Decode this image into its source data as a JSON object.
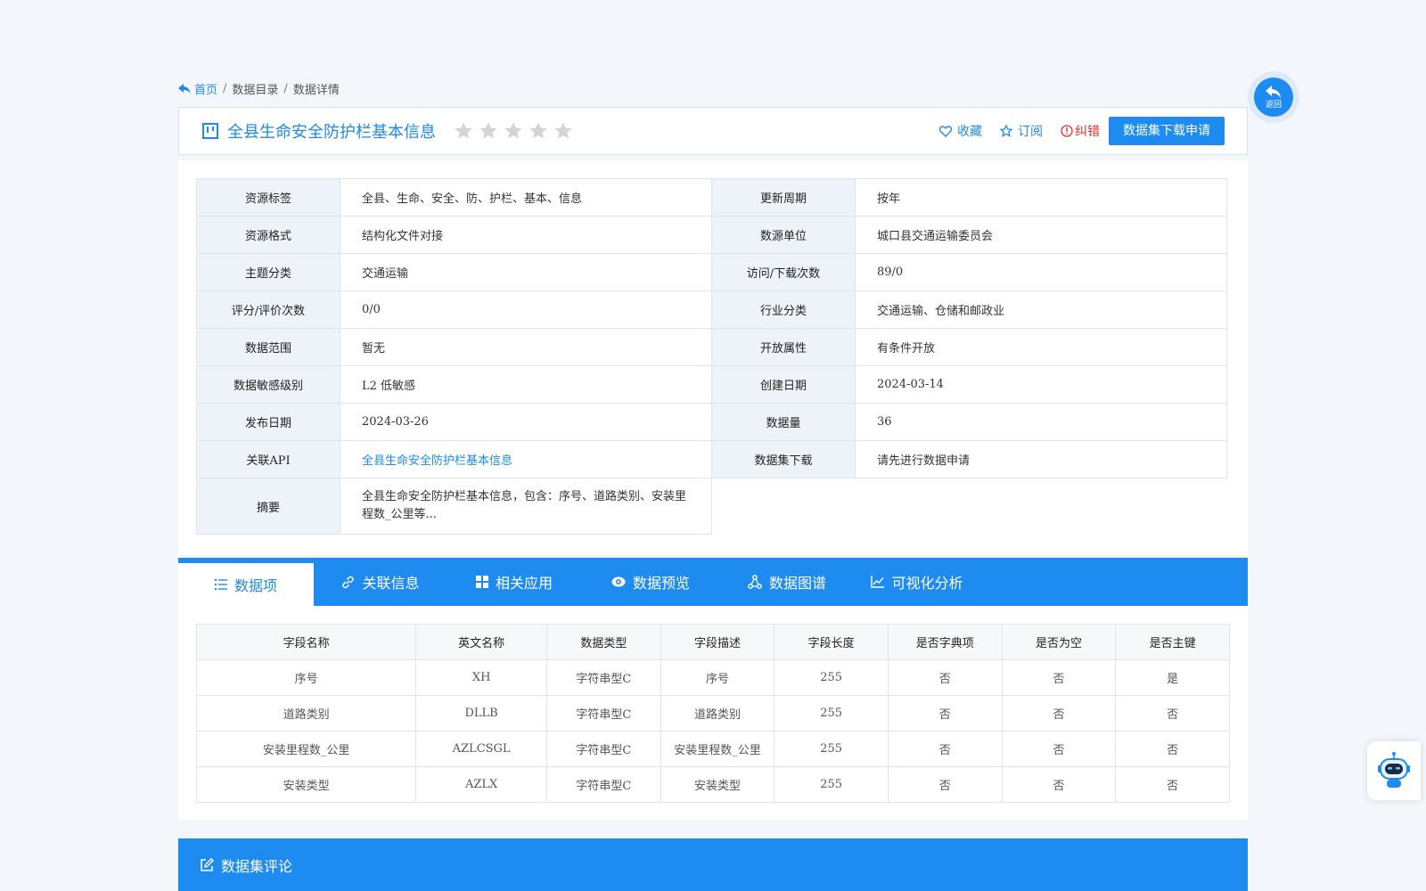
{
  "breadcrumb": {
    "home": "首页",
    "sep1": "/",
    "catalog": "数据目录",
    "sep2": "/",
    "detail": "数据详情"
  },
  "title": {
    "text": "全县生命安全防护栏基本信息",
    "rating_stars": 5,
    "rating_value": 0
  },
  "actions": {
    "favorite": "收藏",
    "subscribe": "订阅",
    "report_error": "纠错",
    "apply": "数据集下载申请"
  },
  "colors": {
    "primary": "#1e8bf0",
    "error": "#e0322d",
    "star": "#d4d4d4"
  },
  "info": {
    "rows": [
      {
        "k1": "资源标签",
        "v1": "全县、生命、安全、防、护栏、基本、信息",
        "k2": "更新周期",
        "v2": "按年"
      },
      {
        "k1": "资源格式",
        "v1": "结构化文件对接",
        "k2": "数源单位",
        "v2": "城口县交通运输委员会"
      },
      {
        "k1": "主题分类",
        "v1": "交通运输",
        "k2": "访问/下载次数",
        "v2": "89/0"
      },
      {
        "k1": "评分/评价次数",
        "v1": "0/0",
        "k2": "行业分类",
        "v2": "交通运输、仓储和邮政业"
      },
      {
        "k1": "数据范围",
        "v1": "暂无",
        "k2": "开放属性",
        "v2": "有条件开放"
      },
      {
        "k1": "数据敏感级别",
        "v1": "L2 低敏感",
        "k2": "创建日期",
        "v2": "2024-03-14"
      },
      {
        "k1": "发布日期",
        "v1": "2024-03-26",
        "k2": "数据量",
        "v2": "36"
      },
      {
        "k1": "关联API",
        "v1": "全县生命安全防护栏基本信息",
        "k2": "数据集下载",
        "v2": "请先进行数据申请"
      }
    ],
    "summary_label": "摘要",
    "summary_value": "全县生命安全防护栏基本信息，包含：序号、道路类别、安装里程数_公里等..."
  },
  "tabs": [
    {
      "label": "数据项",
      "icon": "list-icon"
    },
    {
      "label": "关联信息",
      "icon": "link-icon"
    },
    {
      "label": "相关应用",
      "icon": "grid-icon"
    },
    {
      "label": "数据预览",
      "icon": "eye-icon"
    },
    {
      "label": "数据图谱",
      "icon": "graph-icon"
    },
    {
      "label": "可视化分析",
      "icon": "line-chart-icon"
    }
  ],
  "fields": {
    "headers": [
      "字段名称",
      "英文名称",
      "数据类型",
      "字段描述",
      "字段长度",
      "是否字典项",
      "是否为空",
      "是否主键"
    ],
    "rows": [
      [
        "序号",
        "XH",
        "字符串型C",
        "序号",
        "255",
        "否",
        "否",
        "是"
      ],
      [
        "道路类别",
        "DLLB",
        "字符串型C",
        "道路类别",
        "255",
        "否",
        "否",
        "否"
      ],
      [
        "安装里程数_公里",
        "AZLCSGL",
        "字符串型C",
        "安装里程数_公里",
        "255",
        "否",
        "否",
        "否"
      ],
      [
        "安装类型",
        "AZLX",
        "字符串型C",
        "安装类型",
        "255",
        "否",
        "否",
        "否"
      ]
    ]
  },
  "comments": {
    "title": "数据集评论"
  },
  "back_button": {
    "label": "返回"
  }
}
